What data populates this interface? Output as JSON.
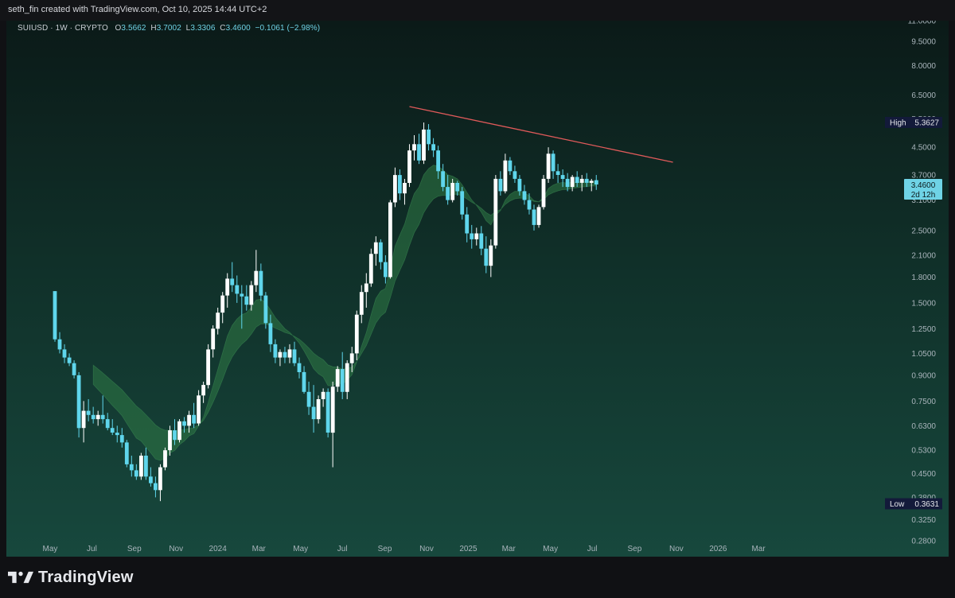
{
  "header": {
    "attribution": "seth_fin created with TradingView.com, Oct 10, 2025 14:44 UTC+2"
  },
  "legend": {
    "symbol": "SUIUSD · 1W · CRYPTO",
    "o_label": "O",
    "o_value": "3.5662",
    "h_label": "H",
    "h_value": "3.7002",
    "l_label": "L",
    "l_value": "3.3306",
    "c_label": "C",
    "c_value": "3.4600",
    "change": "−0.1061 (−2.98%)"
  },
  "footer": {
    "brand": "TradingView"
  },
  "colors": {
    "up": "#ffffff",
    "down": "#5fd6ec",
    "trendline": "#e05a5a",
    "cloud": "#2f7a45",
    "axis_text": "#a9b4bb"
  },
  "chart_data": {
    "type": "candlestick",
    "symbol": "SUIUSD",
    "interval": "1W",
    "y_scale": "log",
    "ylim": [
      0.25,
      11.0
    ],
    "y_ticks": [
      "11.0000",
      "9.5000",
      "8.0000",
      "6.5000",
      "5.5000",
      "4.5000",
      "3.7000",
      "3.1000",
      "2.5000",
      "2.1000",
      "1.8000",
      "1.5000",
      "1.2500",
      "1.0500",
      "0.9000",
      "0.7500",
      "0.6300",
      "0.5300",
      "0.4500",
      "0.3800",
      "0.3250",
      "0.2800"
    ],
    "x_ticks": [
      "May",
      "Jul",
      "Sep",
      "Nov",
      "2024",
      "Mar",
      "May",
      "Jul",
      "Sep",
      "Nov",
      "2025",
      "Mar",
      "May",
      "Jul",
      "Sep",
      "Nov",
      "2026",
      "Mar"
    ],
    "price_labels": {
      "last": "3.4600",
      "countdown": "2d 12h",
      "high_label": "High",
      "high_value": "5.3627",
      "low_label": "Low",
      "low_value": "0.3631"
    },
    "trendline": {
      "from": [
        "2024-10-07",
        6.0
      ],
      "to": [
        "2025-10-27",
        4.05
      ]
    },
    "candles": [
      [
        1.63,
        1.63,
        1.14,
        1.16
      ],
      [
        1.16,
        1.22,
        1.05,
        1.08
      ],
      [
        1.08,
        1.12,
        0.98,
        1.02
      ],
      [
        1.02,
        1.05,
        0.96,
        0.98
      ],
      [
        0.98,
        1.0,
        0.88,
        0.9
      ],
      [
        0.9,
        0.92,
        0.58,
        0.62
      ],
      [
        0.62,
        0.75,
        0.56,
        0.7
      ],
      [
        0.7,
        0.76,
        0.65,
        0.68
      ],
      [
        0.68,
        0.72,
        0.64,
        0.66
      ],
      [
        0.66,
        0.7,
        0.63,
        0.68
      ],
      [
        0.68,
        0.78,
        0.64,
        0.66
      ],
      [
        0.66,
        0.69,
        0.61,
        0.62
      ],
      [
        0.62,
        0.66,
        0.59,
        0.6
      ],
      [
        0.6,
        0.63,
        0.56,
        0.59
      ],
      [
        0.59,
        0.62,
        0.54,
        0.56
      ],
      [
        0.56,
        0.57,
        0.47,
        0.48
      ],
      [
        0.48,
        0.51,
        0.44,
        0.46
      ],
      [
        0.46,
        0.48,
        0.43,
        0.44
      ],
      [
        0.44,
        0.52,
        0.43,
        0.51
      ],
      [
        0.51,
        0.54,
        0.43,
        0.44
      ],
      [
        0.44,
        0.47,
        0.41,
        0.42
      ],
      [
        0.42,
        0.44,
        0.38,
        0.4
      ],
      [
        0.4,
        0.48,
        0.37,
        0.47
      ],
      [
        0.47,
        0.54,
        0.46,
        0.53
      ],
      [
        0.53,
        0.63,
        0.51,
        0.61
      ],
      [
        0.61,
        0.66,
        0.55,
        0.57
      ],
      [
        0.57,
        0.66,
        0.56,
        0.65
      ],
      [
        0.65,
        0.67,
        0.6,
        0.63
      ],
      [
        0.63,
        0.7,
        0.6,
        0.68
      ],
      [
        0.68,
        0.74,
        0.62,
        0.64
      ],
      [
        0.64,
        0.81,
        0.63,
        0.78
      ],
      [
        0.78,
        0.86,
        0.74,
        0.84
      ],
      [
        0.84,
        1.12,
        0.82,
        1.08
      ],
      [
        1.08,
        1.28,
        1.02,
        1.25
      ],
      [
        1.25,
        1.45,
        1.2,
        1.4
      ],
      [
        1.4,
        1.62,
        1.3,
        1.58
      ],
      [
        1.58,
        1.85,
        1.45,
        1.78
      ],
      [
        1.78,
        2.0,
        1.62,
        1.7
      ],
      [
        1.7,
        1.82,
        1.5,
        1.6
      ],
      [
        1.6,
        1.7,
        1.25,
        1.57
      ],
      [
        1.57,
        1.7,
        1.42,
        1.48
      ],
      [
        1.48,
        1.75,
        1.42,
        1.7
      ],
      [
        1.7,
        2.18,
        1.62,
        1.88
      ],
      [
        1.88,
        1.98,
        1.52,
        1.58
      ],
      [
        1.58,
        1.62,
        1.25,
        1.3
      ],
      [
        1.3,
        1.38,
        1.06,
        1.12
      ],
      [
        1.12,
        1.16,
        0.98,
        1.02
      ],
      [
        1.02,
        1.08,
        0.96,
        1.06
      ],
      [
        1.06,
        1.1,
        0.98,
        1.02
      ],
      [
        1.02,
        1.12,
        0.98,
        1.08
      ],
      [
        1.08,
        1.14,
        0.96,
        0.98
      ],
      [
        0.98,
        1.02,
        0.88,
        0.92
      ],
      [
        0.92,
        0.96,
        0.79,
        0.8
      ],
      [
        0.8,
        0.86,
        0.68,
        0.72
      ],
      [
        0.72,
        0.84,
        0.6,
        0.66
      ],
      [
        0.66,
        0.78,
        0.64,
        0.76
      ],
      [
        0.76,
        0.82,
        0.72,
        0.8
      ],
      [
        0.8,
        0.82,
        0.58,
        0.6
      ],
      [
        0.6,
        0.86,
        0.47,
        0.83
      ],
      [
        0.83,
        0.96,
        0.8,
        0.94
      ],
      [
        0.94,
        1.06,
        0.76,
        0.8
      ],
      [
        0.8,
        1.0,
        0.76,
        0.98
      ],
      [
        0.98,
        1.1,
        0.92,
        1.05
      ],
      [
        1.05,
        1.42,
        1.0,
        1.38
      ],
      [
        1.38,
        1.7,
        1.3,
        1.62
      ],
      [
        1.62,
        1.85,
        1.45,
        1.72
      ],
      [
        1.72,
        2.2,
        1.68,
        2.12
      ],
      [
        2.12,
        2.4,
        1.95,
        2.3
      ],
      [
        2.3,
        2.35,
        1.9,
        2.0
      ],
      [
        2.0,
        2.1,
        1.72,
        1.8
      ],
      [
        1.8,
        3.1,
        1.78,
        3.05
      ],
      [
        3.05,
        3.9,
        2.95,
        3.7
      ],
      [
        3.7,
        3.85,
        3.1,
        3.25
      ],
      [
        3.25,
        3.6,
        3.0,
        3.5
      ],
      [
        3.5,
        4.6,
        3.4,
        4.4
      ],
      [
        4.4,
        4.9,
        4.1,
        4.6
      ],
      [
        4.6,
        4.95,
        4.0,
        4.1
      ],
      [
        4.1,
        5.36,
        4.0,
        5.1
      ],
      [
        5.1,
        5.3,
        4.4,
        4.6
      ],
      [
        4.6,
        4.8,
        4.2,
        4.4
      ],
      [
        4.4,
        4.55,
        3.6,
        3.8
      ],
      [
        3.8,
        4.0,
        3.3,
        3.4
      ],
      [
        3.4,
        3.7,
        3.0,
        3.1
      ],
      [
        3.1,
        3.6,
        3.05,
        3.5
      ],
      [
        3.5,
        3.55,
        3.2,
        3.3
      ],
      [
        3.3,
        3.4,
        2.7,
        2.8
      ],
      [
        2.8,
        2.95,
        2.3,
        2.45
      ],
      [
        2.45,
        2.6,
        2.2,
        2.35
      ],
      [
        2.35,
        2.55,
        2.25,
        2.45
      ],
      [
        2.45,
        2.58,
        2.1,
        2.2
      ],
      [
        2.2,
        2.4,
        1.85,
        1.95
      ],
      [
        1.95,
        2.35,
        1.8,
        2.25
      ],
      [
        2.25,
        3.7,
        2.2,
        3.6
      ],
      [
        3.6,
        3.8,
        3.2,
        3.3
      ],
      [
        3.3,
        4.3,
        3.25,
        4.1
      ],
      [
        4.1,
        4.2,
        3.7,
        3.8
      ],
      [
        3.8,
        3.95,
        3.5,
        3.6
      ],
      [
        3.6,
        3.7,
        3.2,
        3.3
      ],
      [
        3.3,
        3.45,
        3.0,
        3.1
      ],
      [
        3.1,
        3.25,
        2.8,
        2.9
      ],
      [
        2.9,
        3.0,
        2.5,
        2.6
      ],
      [
        2.6,
        3.0,
        2.55,
        2.95
      ],
      [
        2.95,
        3.7,
        2.9,
        3.6
      ],
      [
        3.6,
        4.5,
        3.5,
        4.3
      ],
      [
        4.3,
        4.4,
        3.6,
        3.8
      ],
      [
        3.8,
        4.0,
        3.5,
        3.7
      ],
      [
        3.7,
        3.85,
        3.4,
        3.6
      ],
      [
        3.6,
        3.75,
        3.3,
        3.4
      ],
      [
        3.4,
        3.7,
        3.3,
        3.65
      ],
      [
        3.65,
        3.8,
        3.4,
        3.5
      ],
      [
        3.5,
        3.7,
        3.3,
        3.6
      ],
      [
        3.6,
        3.75,
        3.4,
        3.5
      ],
      [
        3.5,
        3.6,
        3.3,
        3.55
      ],
      [
        3.5662,
        3.7002,
        3.3306,
        3.46
      ]
    ]
  }
}
